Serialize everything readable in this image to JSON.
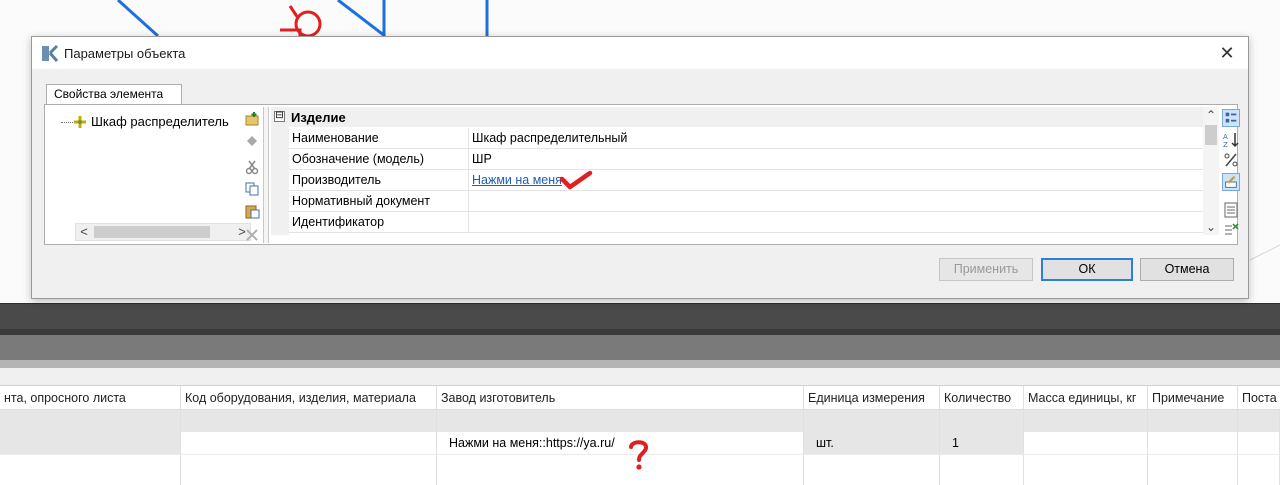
{
  "dialog": {
    "title": "Параметры объекта",
    "tab_label": "Свойства элемента",
    "close_symbol": "✕",
    "tree": {
      "item_label": "Шкаф распределитель",
      "scroll_left": "<",
      "scroll_right": ">"
    },
    "group": {
      "toggle": "⊟",
      "label": "Изделие"
    },
    "properties": [
      {
        "name": "Наименование",
        "value": "Шкаф распределительный",
        "is_link": false
      },
      {
        "name": "Обозначение (модель)",
        "value": "ШР",
        "is_link": false
      },
      {
        "name": "Производитель",
        "value": "Нажми на меня",
        "is_link": true
      },
      {
        "name": "Нормативный документ",
        "value": "",
        "is_link": false
      },
      {
        "name": "Идентификатор",
        "value": "",
        "is_link": false
      }
    ],
    "scroll_up": "⌃",
    "scroll_down": "⌄",
    "buttons": {
      "apply": "Применить",
      "ok": "ОК",
      "cancel": "Отмена"
    }
  },
  "spec_table": {
    "headers": [
      "нта, опросного листа",
      "Код оборудования, изделия, материала",
      "Завод изготовитель",
      "Единица измерения",
      "Количество",
      "Масса единицы, кг",
      "Примечание",
      "Поста"
    ],
    "row": {
      "manufacturer": "Нажми на меня::https://ya.ru/",
      "unit": "шт.",
      "quantity": "1"
    }
  },
  "colors": {
    "link": "#1a5fb4",
    "annotation_red": "#e02020",
    "cad_line_blue": "#1e6fe0",
    "default_button_border": "#2f7fd6"
  }
}
